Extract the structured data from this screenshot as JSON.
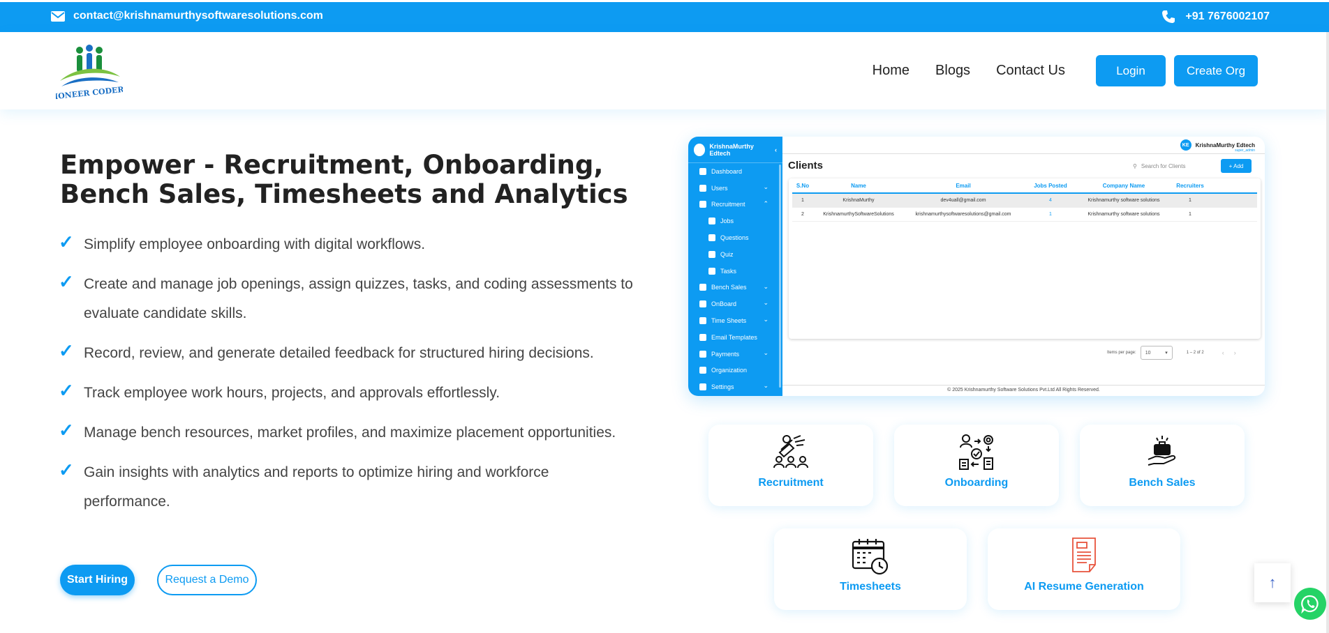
{
  "topbar": {
    "email": "contact@krishnamurthysoftwaresolutions.com",
    "phone": "+91 7676002107"
  },
  "header": {
    "logo_text": "PIONEER CODERS",
    "nav": [
      "Home",
      "Blogs",
      "Contact Us"
    ],
    "login_label": "Login",
    "create_org_label": "Create Org"
  },
  "hero": {
    "title_line1": "Empower - Recruitment, Onboarding,",
    "title_line2": "Bench Sales, Timesheets and Analytics",
    "features": [
      "Simplify employee onboarding with digital workflows.",
      "Create and manage job openings, assign quizzes, tasks, and coding assessments to evaluate candidate skills.",
      "Record, review, and generate detailed feedback for structured hiring decisions.",
      "Track employee work hours, projects, and approvals effortlessly.",
      "Manage bench resources, market profiles, and maximize placement opportunities.",
      "Gain insights with analytics and reports to optimize hiring and workforce performance."
    ],
    "start_label": "Start Hiring",
    "demo_label": "Request a Demo"
  },
  "preview": {
    "org_name": "KrishnaMurthy Edtech",
    "sidebar": [
      "Dashboard",
      "Users",
      "Recruitment",
      "Jobs",
      "Questions",
      "Quiz",
      "Tasks",
      "Bench Sales",
      "OnBoard",
      "Time Sheets",
      "Email Templates",
      "Payments",
      "Organization",
      "Settings"
    ],
    "user_initials": "KE",
    "user_name": "KrishnaMurthy Edtech",
    "user_role": "super_admin",
    "page_title": "Clients",
    "search_placeholder": "Search for Clients",
    "add_label": "+ Add",
    "columns": [
      "S.No",
      "Name",
      "Email",
      "Jobs Posted",
      "Company Name",
      "Recruiters"
    ],
    "rows": [
      [
        "1",
        "KrishnaMurthy",
        "dev4uall@gmail.com",
        "4",
        "Krishnamurthy software solutions",
        "1"
      ],
      [
        "2",
        "KrishnamurthySoftwareSolutions",
        "krishnamurthysoftwaresolutions@gmail.com",
        "1",
        "Krishnamurthy software solutions",
        "1"
      ]
    ],
    "items_per_page_label": "Items per page:",
    "items_per_page": "10",
    "range": "1 – 2 of 2",
    "footer": "© 2025 Krishnamurthy Software Solutions Pvt.Ltd All Rights Reserved."
  },
  "modules": {
    "recruitment": "Recruitment",
    "onboarding": "Onboarding",
    "bench_sales": "Bench Sales",
    "timesheets": "Timesheets",
    "ai_resume": "AI Resume Generation"
  },
  "colors": {
    "accent": "#0d9bf2",
    "whatsapp": "#25d366"
  }
}
